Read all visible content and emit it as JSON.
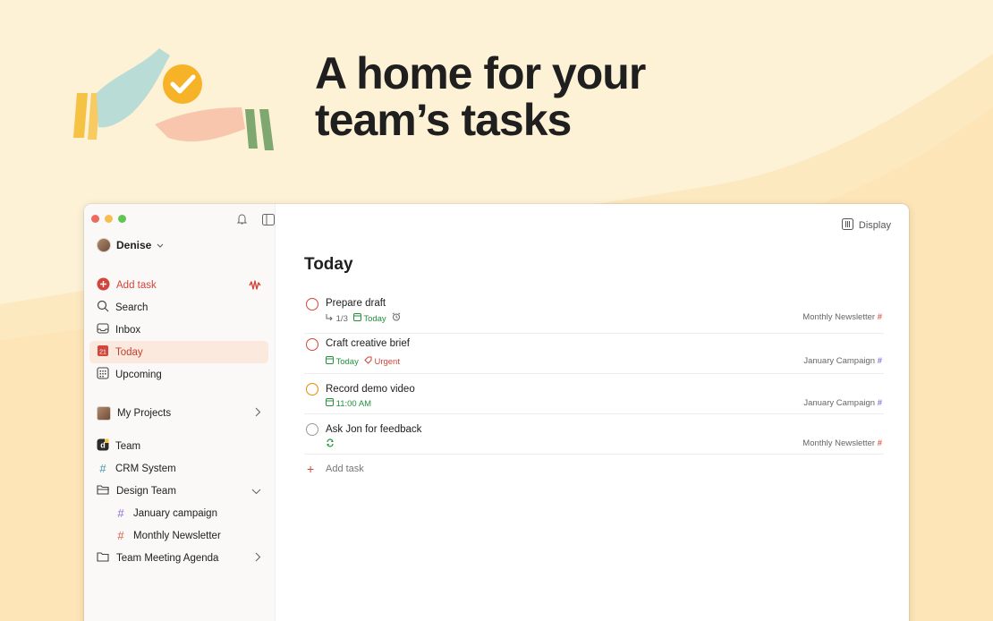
{
  "hero": {
    "title_line1": "A home for your",
    "title_line2": "team’s tasks"
  },
  "colors": {
    "accent": "#d1453b",
    "today_green": "#25903f",
    "background": "#fdf1d6"
  },
  "sidebar": {
    "user_name": "Denise",
    "items": [
      {
        "label": "Add task",
        "icon": "plus-circle-icon"
      },
      {
        "label": "Search",
        "icon": "search-icon"
      },
      {
        "label": "Inbox",
        "icon": "inbox-icon"
      },
      {
        "label": "Today",
        "icon": "calendar-today-icon",
        "date": "21"
      },
      {
        "label": "Upcoming",
        "icon": "calendar-grid-icon"
      }
    ],
    "my_projects": "My Projects",
    "team": "Team",
    "projects": [
      {
        "label": "CRM System",
        "icon": "hash-icon"
      },
      {
        "label": "Design Team",
        "icon": "folder-icon"
      },
      {
        "label": "January campaign",
        "icon": "hash-icon"
      },
      {
        "label": "Monthly Newsletter",
        "icon": "hash-icon"
      },
      {
        "label": "Team Meeting Agenda",
        "icon": "folder-icon"
      }
    ]
  },
  "main": {
    "display_label": "Display",
    "title": "Today",
    "tasks": [
      {
        "name": "Prepare draft",
        "subtasks": "1/3",
        "date": "Today",
        "project": "Monthly Newsletter"
      },
      {
        "name": "Craft creative brief",
        "date": "Today",
        "label": "Urgent",
        "project": "January Campaign"
      },
      {
        "name": "Record demo video",
        "time": "11:00 AM",
        "project": "January Campaign"
      },
      {
        "name": "Ask Jon for feedback",
        "project": "Monthly Newsletter"
      }
    ],
    "add_task_label": "Add task"
  }
}
